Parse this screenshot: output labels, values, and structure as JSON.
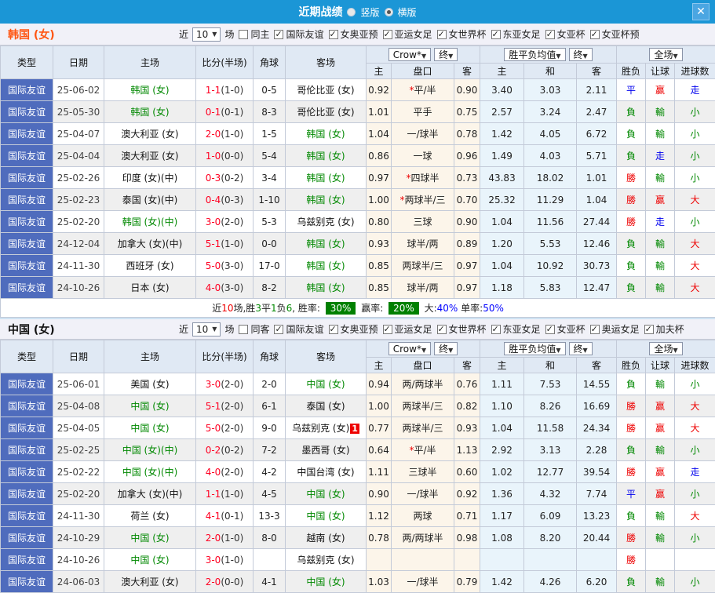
{
  "titlebar": {
    "title": "近期战绩",
    "options": [
      {
        "label": "竖版",
        "selected": false
      },
      {
        "label": "横版",
        "selected": true
      }
    ],
    "close_icon": "✕"
  },
  "colors": {
    "titlebar": "#1b96d6",
    "type_cell": "#4f6cbd",
    "win": "#e00",
    "lose": "#080",
    "draw": "#00e"
  },
  "table_header": {
    "cols": [
      "类型",
      "日期",
      "主场",
      "比分(半场)",
      "角球",
      "客场"
    ],
    "sub": [
      "主",
      "盘口",
      "客",
      "主",
      "和",
      "客",
      "胜负",
      "让球",
      "进球数"
    ],
    "odds_dd": "Crow*",
    "odds_final": "终",
    "avg_dd": "胜平负均值",
    "avg_final": "终",
    "full_dd": "全场"
  },
  "sections": [
    {
      "team": "韩国 (女)",
      "accent": "#ff5511",
      "filter": {
        "prefix": "近",
        "count": "10",
        "suffix": "场",
        "same": {
          "label": "同主",
          "checked": false
        },
        "comps": [
          {
            "label": "国际友谊",
            "checked": true
          },
          {
            "label": "女奥亚预",
            "checked": true
          },
          {
            "label": "亚运女足",
            "checked": true
          },
          {
            "label": "女世界杯",
            "checked": true
          },
          {
            "label": "东亚女足",
            "checked": true
          },
          {
            "label": "女亚杯",
            "checked": true
          },
          {
            "label": "女亚杯预",
            "checked": true
          }
        ]
      },
      "rows": [
        {
          "type": "国际友谊",
          "date": "25-06-02",
          "home": "韩国 (女)",
          "home_hl": true,
          "score": "1-1",
          "half": "(1-0)",
          "corner": "0-5",
          "away": "哥伦比亚 (女)",
          "away_hl": false,
          "away_badge": "",
          "o1": "0.92",
          "star": true,
          "hcp": "平/半",
          "o2": "0.90",
          "w": "3.40",
          "d": "3.03",
          "l": "2.11",
          "res": [
            [
              "平",
              "b"
            ],
            [
              "赢",
              "r"
            ],
            [
              "走",
              "b"
            ]
          ]
        },
        {
          "type": "国际友谊",
          "date": "25-05-30",
          "home": "韩国 (女)",
          "home_hl": true,
          "score": "0-1",
          "half": "(0-1)",
          "corner": "8-3",
          "away": "哥伦比亚 (女)",
          "away_hl": false,
          "away_badge": "",
          "o1": "1.01",
          "star": false,
          "hcp": "平手",
          "o2": "0.75",
          "w": "2.57",
          "d": "3.24",
          "l": "2.47",
          "res": [
            [
              "負",
              "g"
            ],
            [
              "輸",
              "g"
            ],
            [
              "小",
              "g"
            ]
          ]
        },
        {
          "type": "国际友谊",
          "date": "25-04-07",
          "home": "澳大利亚 (女)",
          "home_hl": false,
          "score": "2-0",
          "half": "(1-0)",
          "corner": "1-5",
          "away": "韩国 (女)",
          "away_hl": true,
          "away_badge": "",
          "o1": "1.04",
          "star": false,
          "hcp": "一/球半",
          "o2": "0.78",
          "w": "1.42",
          "d": "4.05",
          "l": "6.72",
          "res": [
            [
              "負",
              "g"
            ],
            [
              "輸",
              "g"
            ],
            [
              "小",
              "g"
            ]
          ]
        },
        {
          "type": "国际友谊",
          "date": "25-04-04",
          "home": "澳大利亚 (女)",
          "home_hl": false,
          "score": "1-0",
          "half": "(0-0)",
          "corner": "5-4",
          "away": "韩国 (女)",
          "away_hl": true,
          "away_badge": "",
          "o1": "0.86",
          "star": false,
          "hcp": "一球",
          "o2": "0.96",
          "w": "1.49",
          "d": "4.03",
          "l": "5.71",
          "res": [
            [
              "負",
              "g"
            ],
            [
              "走",
              "b"
            ],
            [
              "小",
              "g"
            ]
          ]
        },
        {
          "type": "国际友谊",
          "date": "25-02-26",
          "home": "印度 (女)(中)",
          "home_hl": false,
          "score": "0-3",
          "half": "(0-2)",
          "corner": "3-4",
          "away": "韩国 (女)",
          "away_hl": true,
          "away_badge": "",
          "o1": "0.97",
          "star": true,
          "hcp": "四球半",
          "o2": "0.73",
          "w": "43.83",
          "d": "18.02",
          "l": "1.01",
          "res": [
            [
              "勝",
              "r"
            ],
            [
              "輸",
              "g"
            ],
            [
              "小",
              "g"
            ]
          ]
        },
        {
          "type": "国际友谊",
          "date": "25-02-23",
          "home": "泰国 (女)(中)",
          "home_hl": false,
          "score": "0-4",
          "half": "(0-3)",
          "corner": "1-10",
          "away": "韩国 (女)",
          "away_hl": true,
          "away_badge": "",
          "o1": "1.00",
          "star": true,
          "hcp": "两球半/三",
          "o2": "0.70",
          "w": "25.32",
          "d": "11.29",
          "l": "1.04",
          "res": [
            [
              "勝",
              "r"
            ],
            [
              "赢",
              "r"
            ],
            [
              "大",
              "r"
            ]
          ]
        },
        {
          "type": "国际友谊",
          "date": "25-02-20",
          "home": "韩国 (女)(中)",
          "home_hl": true,
          "score": "3-0",
          "half": "(2-0)",
          "corner": "5-3",
          "away": "乌兹别克 (女)",
          "away_hl": false,
          "away_badge": "",
          "o1": "0.80",
          "star": false,
          "hcp": "三球",
          "o2": "0.90",
          "w": "1.04",
          "d": "11.56",
          "l": "27.44",
          "res": [
            [
              "勝",
              "r"
            ],
            [
              "走",
              "b"
            ],
            [
              "小",
              "g"
            ]
          ]
        },
        {
          "type": "国际友谊",
          "date": "24-12-04",
          "home": "加拿大 (女)(中)",
          "home_hl": false,
          "score": "5-1",
          "half": "(1-0)",
          "corner": "0-0",
          "away": "韩国 (女)",
          "away_hl": true,
          "away_badge": "",
          "o1": "0.93",
          "star": false,
          "hcp": "球半/两",
          "o2": "0.89",
          "w": "1.20",
          "d": "5.53",
          "l": "12.46",
          "res": [
            [
              "負",
              "g"
            ],
            [
              "輸",
              "g"
            ],
            [
              "大",
              "r"
            ]
          ]
        },
        {
          "type": "国际友谊",
          "date": "24-11-30",
          "home": "西班牙 (女)",
          "home_hl": false,
          "score": "5-0",
          "half": "(3-0)",
          "corner": "17-0",
          "away": "韩国 (女)",
          "away_hl": true,
          "away_badge": "",
          "o1": "0.85",
          "star": false,
          "hcp": "两球半/三",
          "o2": "0.97",
          "w": "1.04",
          "d": "10.92",
          "l": "30.73",
          "res": [
            [
              "負",
              "g"
            ],
            [
              "輸",
              "g"
            ],
            [
              "大",
              "r"
            ]
          ]
        },
        {
          "type": "国际友谊",
          "date": "24-10-26",
          "home": "日本 (女)",
          "home_hl": false,
          "score": "4-0",
          "half": "(3-0)",
          "corner": "8-2",
          "away": "韩国 (女)",
          "away_hl": true,
          "away_badge": "",
          "o1": "0.85",
          "star": false,
          "hcp": "球半/两",
          "o2": "0.97",
          "w": "1.18",
          "d": "5.83",
          "l": "12.47",
          "res": [
            [
              "負",
              "g"
            ],
            [
              "輸",
              "g"
            ],
            [
              "大",
              "r"
            ]
          ]
        }
      ],
      "summary": [
        {
          "t": "近",
          "c": "k"
        },
        {
          "t": "10",
          "c": "r"
        },
        {
          "t": "场,胜",
          "c": "k"
        },
        {
          "t": "3",
          "c": "g"
        },
        {
          "t": "平",
          "c": "k"
        },
        {
          "t": "1",
          "c": "g"
        },
        {
          "t": "负",
          "c": "k"
        },
        {
          "t": "6",
          "c": "g"
        },
        {
          "t": ", 胜率: ",
          "c": "k"
        },
        {
          "t": "30%",
          "c": "badge"
        },
        {
          "t": " 赢率: ",
          "c": "k"
        },
        {
          "t": "20%",
          "c": "badge"
        },
        {
          "t": " 大:",
          "c": "k"
        },
        {
          "t": "40%",
          "c": "b"
        },
        {
          "t": " 单率:",
          "c": "k"
        },
        {
          "t": "50%",
          "c": "b"
        }
      ]
    },
    {
      "team": "中国 (女)",
      "accent": "#111111",
      "filter": {
        "prefix": "近",
        "count": "10",
        "suffix": "场",
        "same": {
          "label": "同客",
          "checked": false
        },
        "comps": [
          {
            "label": "国际友谊",
            "checked": true
          },
          {
            "label": "女奥亚预",
            "checked": true
          },
          {
            "label": "亚运女足",
            "checked": true
          },
          {
            "label": "女世界杯",
            "checked": true
          },
          {
            "label": "东亚女足",
            "checked": true
          },
          {
            "label": "女亚杯",
            "checked": true
          },
          {
            "label": "奥运女足",
            "checked": true
          },
          {
            "label": "加夫杯",
            "checked": true
          }
        ]
      },
      "rows": [
        {
          "type": "国际友谊",
          "date": "25-06-01",
          "home": "美国 (女)",
          "home_hl": false,
          "score": "3-0",
          "half": "(2-0)",
          "corner": "2-0",
          "away": "中国 (女)",
          "away_hl": true,
          "away_badge": "",
          "o1": "0.94",
          "star": false,
          "hcp": "两/两球半",
          "o2": "0.76",
          "w": "1.11",
          "d": "7.53",
          "l": "14.55",
          "res": [
            [
              "負",
              "g"
            ],
            [
              "輸",
              "g"
            ],
            [
              "小",
              "g"
            ]
          ]
        },
        {
          "type": "国际友谊",
          "date": "25-04-08",
          "home": "中国 (女)",
          "home_hl": true,
          "score": "5-1",
          "half": "(2-0)",
          "corner": "6-1",
          "away": "泰国 (女)",
          "away_hl": false,
          "away_badge": "",
          "o1": "1.00",
          "star": false,
          "hcp": "两球半/三",
          "o2": "0.82",
          "w": "1.10",
          "d": "8.26",
          "l": "16.69",
          "res": [
            [
              "勝",
              "r"
            ],
            [
              "赢",
              "r"
            ],
            [
              "大",
              "r"
            ]
          ]
        },
        {
          "type": "国际友谊",
          "date": "25-04-05",
          "home": "中国 (女)",
          "home_hl": true,
          "score": "5-0",
          "half": "(2-0)",
          "corner": "9-0",
          "away": "乌兹别克 (女)",
          "away_hl": false,
          "away_badge": "1",
          "o1": "0.77",
          "star": false,
          "hcp": "两球半/三",
          "o2": "0.93",
          "w": "1.04",
          "d": "11.58",
          "l": "24.34",
          "res": [
            [
              "勝",
              "r"
            ],
            [
              "赢",
              "r"
            ],
            [
              "大",
              "r"
            ]
          ]
        },
        {
          "type": "国际友谊",
          "date": "25-02-25",
          "home": "中国 (女)(中)",
          "home_hl": true,
          "score": "0-2",
          "half": "(0-2)",
          "corner": "7-2",
          "away": "墨西哥 (女)",
          "away_hl": false,
          "away_badge": "",
          "o1": "0.64",
          "star": true,
          "hcp": "平/半",
          "o2": "1.13",
          "w": "2.92",
          "d": "3.13",
          "l": "2.28",
          "res": [
            [
              "負",
              "g"
            ],
            [
              "輸",
              "g"
            ],
            [
              "小",
              "g"
            ]
          ]
        },
        {
          "type": "国际友谊",
          "date": "25-02-22",
          "home": "中国 (女)(中)",
          "home_hl": true,
          "score": "4-0",
          "half": "(2-0)",
          "corner": "4-2",
          "away": "中国台湾 (女)",
          "away_hl": false,
          "away_badge": "",
          "o1": "1.11",
          "star": false,
          "hcp": "三球半",
          "o2": "0.60",
          "w": "1.02",
          "d": "12.77",
          "l": "39.54",
          "res": [
            [
              "勝",
              "r"
            ],
            [
              "赢",
              "r"
            ],
            [
              "走",
              "b"
            ]
          ]
        },
        {
          "type": "国际友谊",
          "date": "25-02-20",
          "home": "加拿大 (女)(中)",
          "home_hl": false,
          "score": "1-1",
          "half": "(1-0)",
          "corner": "4-5",
          "away": "中国 (女)",
          "away_hl": true,
          "away_badge": "",
          "o1": "0.90",
          "star": false,
          "hcp": "一/球半",
          "o2": "0.92",
          "w": "1.36",
          "d": "4.32",
          "l": "7.74",
          "res": [
            [
              "平",
              "b"
            ],
            [
              "赢",
              "r"
            ],
            [
              "小",
              "g"
            ]
          ]
        },
        {
          "type": "国际友谊",
          "date": "24-11-30",
          "home": "荷兰 (女)",
          "home_hl": false,
          "score": "4-1",
          "half": "(0-1)",
          "corner": "13-3",
          "away": "中国 (女)",
          "away_hl": true,
          "away_badge": "",
          "o1": "1.12",
          "star": false,
          "hcp": "两球",
          "o2": "0.71",
          "w": "1.17",
          "d": "6.09",
          "l": "13.23",
          "res": [
            [
              "負",
              "g"
            ],
            [
              "輸",
              "g"
            ],
            [
              "大",
              "r"
            ]
          ]
        },
        {
          "type": "国际友谊",
          "date": "24-10-29",
          "home": "中国 (女)",
          "home_hl": true,
          "score": "2-0",
          "half": "(1-0)",
          "corner": "8-0",
          "away": "越南 (女)",
          "away_hl": false,
          "away_badge": "",
          "o1": "0.78",
          "star": false,
          "hcp": "两/两球半",
          "o2": "0.98",
          "w": "1.08",
          "d": "8.20",
          "l": "20.44",
          "res": [
            [
              "勝",
              "r"
            ],
            [
              "輸",
              "g"
            ],
            [
              "小",
              "g"
            ]
          ]
        },
        {
          "type": "国际友谊",
          "date": "24-10-26",
          "home": "中国 (女)",
          "home_hl": true,
          "score": "3-0",
          "half": "(1-0)",
          "corner": "",
          "away": "乌兹别克 (女)",
          "away_hl": false,
          "away_badge": "",
          "o1": "",
          "star": false,
          "hcp": "",
          "o2": "",
          "w": "",
          "d": "",
          "l": "",
          "res": [
            [
              "勝",
              "r"
            ],
            [
              "",
              ""
            ],
            [
              "",
              ""
            ]
          ]
        },
        {
          "type": "国际友谊",
          "date": "24-06-03",
          "home": "澳大利亚 (女)",
          "home_hl": false,
          "score": "2-0",
          "half": "(0-0)",
          "corner": "4-1",
          "away": "中国 (女)",
          "away_hl": true,
          "away_badge": "",
          "o1": "1.03",
          "star": false,
          "hcp": "一/球半",
          "o2": "0.79",
          "w": "1.42",
          "d": "4.26",
          "l": "6.20",
          "res": [
            [
              "負",
              "g"
            ],
            [
              "輸",
              "g"
            ],
            [
              "小",
              "g"
            ]
          ]
        }
      ],
      "summary": null
    }
  ]
}
